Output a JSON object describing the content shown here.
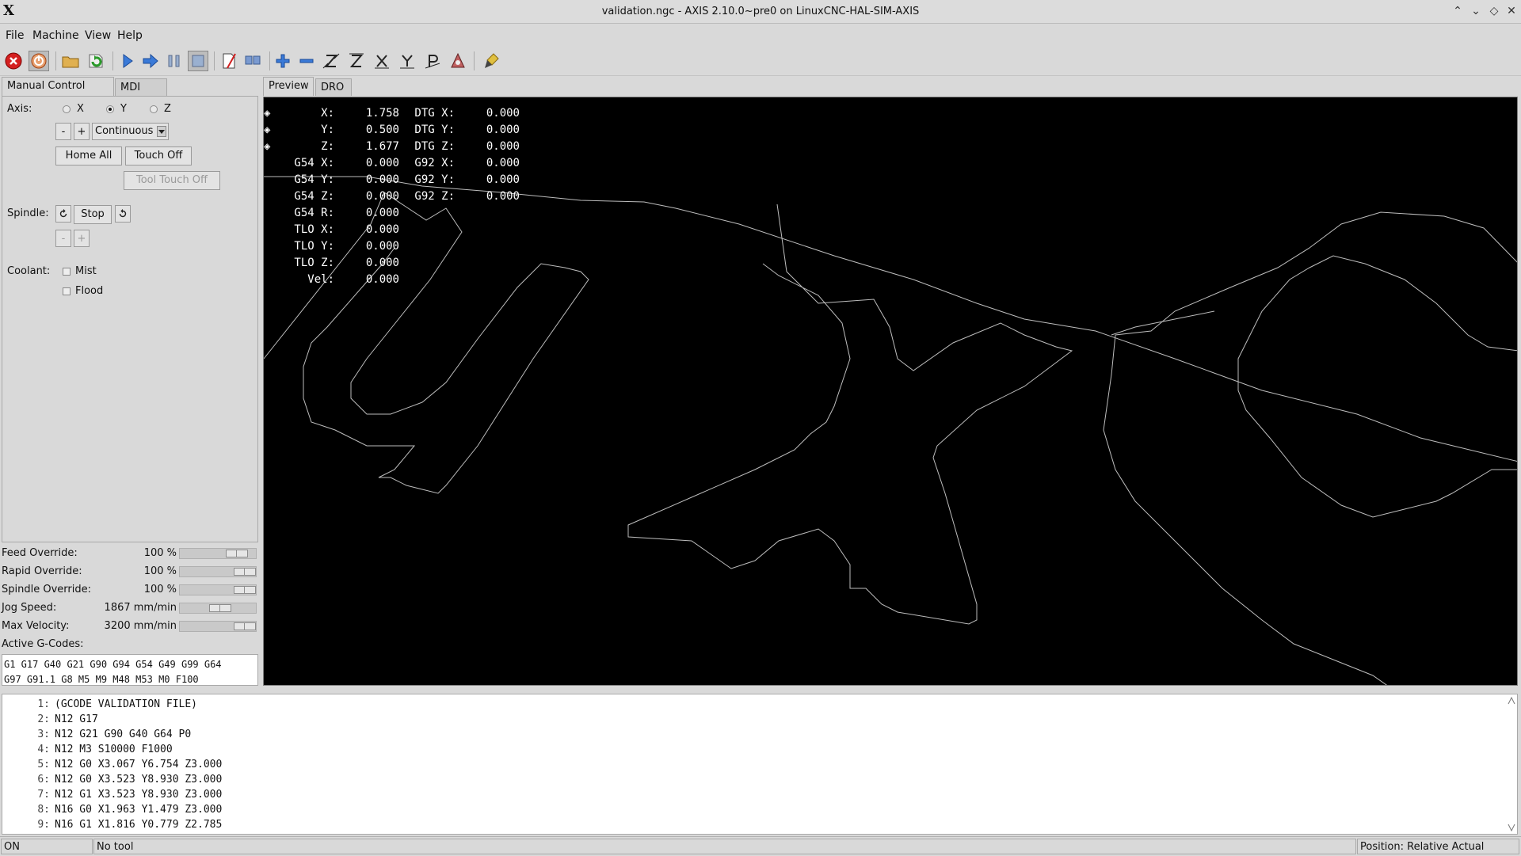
{
  "window": {
    "app_glyph": "X",
    "title": "validation.ngc - AXIS 2.10.0~pre0 on LinuxCNC-HAL-SIM-AXIS",
    "controls": [
      "⌃",
      "⌄",
      "◇",
      "✕"
    ]
  },
  "menu": {
    "items": [
      "File",
      "Machine",
      "View",
      "Help"
    ]
  },
  "toolbar": {
    "icons": [
      "estop-icon",
      "power-icon",
      "open-file-icon",
      "reload-icon",
      "run-icon",
      "step-icon",
      "pause-icon",
      "stop-icon",
      "block-delete-icon",
      "optional-stop-icon",
      "zoom-in-icon",
      "zoom-out-icon",
      "view-z-icon",
      "view-z2-icon",
      "view-x-icon",
      "view-y-icon",
      "view-p-icon",
      "rotate-icon",
      "clear-plot-icon"
    ]
  },
  "left_tabs": {
    "manual": "Manual Control [F3]",
    "mdi": "MDI [F5]"
  },
  "manual": {
    "axis_label": "Axis:",
    "axes": [
      "X",
      "Y",
      "Z"
    ],
    "selected_axis": "Y",
    "jog_minus": "-",
    "jog_plus": "+",
    "jog_mode": "Continuous",
    "home_all": "Home All",
    "touch_off": "Touch Off",
    "tool_touch_off": "Tool Touch Off",
    "spindle_label": "Spindle:",
    "spindle_stop": "Stop",
    "spindle_minus": "-",
    "spindle_plus": "+",
    "coolant_label": "Coolant:",
    "mist": "Mist",
    "flood": "Flood"
  },
  "overrides": [
    {
      "label": "Feed Override:",
      "value": "100 %",
      "level": 0.85
    },
    {
      "label": "Rapid Override:",
      "value": "100 %",
      "level": 1.0
    },
    {
      "label": "Spindle Override:",
      "value": "100 %",
      "level": 1.0
    },
    {
      "label": "Jog Speed:",
      "value": "1867 mm/min",
      "level": 0.55
    },
    {
      "label": "Max Velocity:",
      "value": "3200 mm/min",
      "level": 1.0
    }
  ],
  "active_gcodes": {
    "label": "Active G-Codes:",
    "line1": "G1 G17 G40 G21 G90 G94 G54 G49 G99 G64",
    "line2": "G97 G91.1 G8 M5 M9 M48 M53 M0 F100"
  },
  "preview_tabs": {
    "preview": "Preview",
    "dro": "DRO"
  },
  "dro": [
    {
      "l1": "X:",
      "v1": "1.758",
      "l2": "DTG X:",
      "v2": "0.000"
    },
    {
      "l1": "Y:",
      "v1": "0.500",
      "l2": "DTG Y:",
      "v2": "0.000"
    },
    {
      "l1": "Z:",
      "v1": "1.677",
      "l2": "DTG Z:",
      "v2": "0.000"
    },
    {
      "l1": "G54 X:",
      "v1": "0.000",
      "l2": "G92 X:",
      "v2": "0.000"
    },
    {
      "l1": "G54 Y:",
      "v1": "0.000",
      "l2": "G92 Y:",
      "v2": "0.000"
    },
    {
      "l1": "G54 Z:",
      "v1": "0.000",
      "l2": "G92 Z:",
      "v2": "0.000"
    },
    {
      "l1": "G54 R:",
      "v1": "0.000",
      "l2": "",
      "v2": ""
    },
    {
      "l1": "TLO X:",
      "v1": "0.000",
      "l2": "",
      "v2": ""
    },
    {
      "l1": "TLO Y:",
      "v1": "0.000",
      "l2": "",
      "v2": ""
    },
    {
      "l1": "TLO Z:",
      "v1": "0.000",
      "l2": "",
      "v2": ""
    },
    {
      "l1": "Vel:",
      "v1": "0.000",
      "l2": "",
      "v2": ""
    }
  ],
  "gcode_lines": [
    {
      "n": "1:",
      "code": "(GCODE VALIDATION FILE)"
    },
    {
      "n": "2:",
      "code": "N12 G17"
    },
    {
      "n": "3:",
      "code": "N12 G21 G90 G40 G64 P0"
    },
    {
      "n": "4:",
      "code": "N12 M3 S10000 F1000"
    },
    {
      "n": "5:",
      "code": "N12 G0 X3.067 Y6.754 Z3.000"
    },
    {
      "n": "6:",
      "code": "N12 G0 X3.523 Y8.930 Z3.000"
    },
    {
      "n": "7:",
      "code": "N12 G1 X3.523 Y8.930 Z3.000"
    },
    {
      "n": "8:",
      "code": "N16 G0 X1.963 Y1.479 Z3.000"
    },
    {
      "n": "9:",
      "code": "N16 G1 X1.816 Y0.779 Z2.785"
    }
  ],
  "status": {
    "state": "ON",
    "tool": "No tool",
    "position": "Position: Relative Actual"
  }
}
